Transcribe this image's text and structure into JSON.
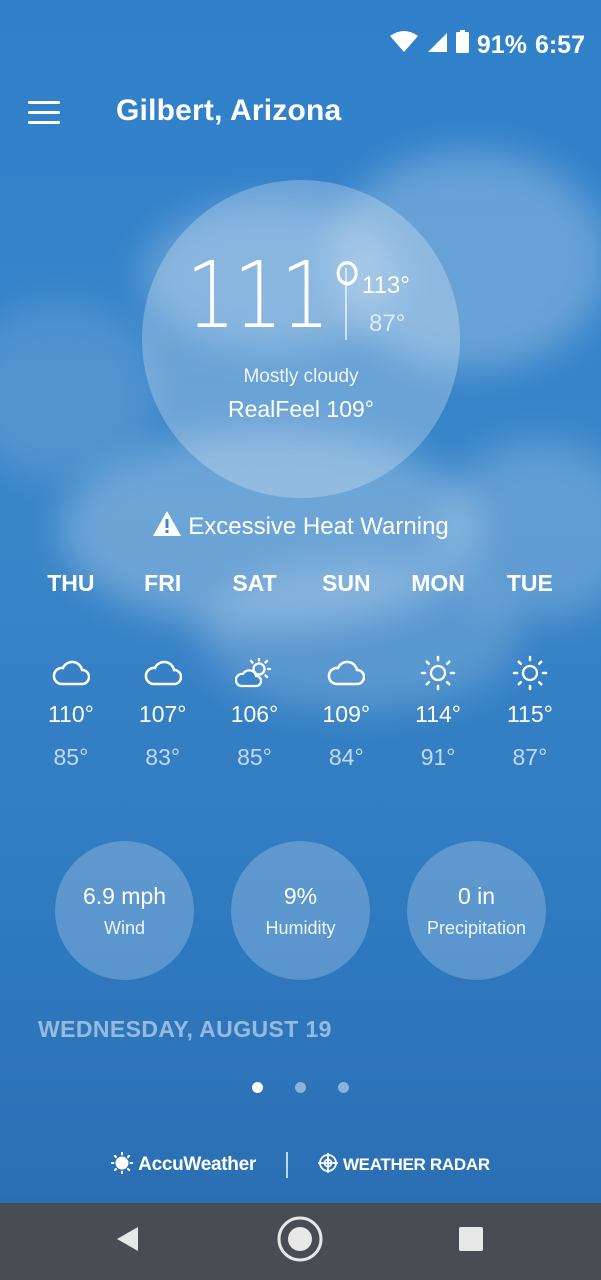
{
  "status_bar": {
    "battery": "91%",
    "time": "6:57",
    "icons": [
      "wifi-icon",
      "signal-icon",
      "battery-icon"
    ]
  },
  "header": {
    "city": "Gilbert, Arizona",
    "menu_icon": "hamburger-menu-icon"
  },
  "current": {
    "temperature": "111°",
    "high": "113°",
    "low": "87°",
    "condition": "Mostly cloudy",
    "realfeel": "RealFeel 109°"
  },
  "alert": {
    "text": "Excessive Heat Warning",
    "icon": "warning-icon"
  },
  "forecast": [
    {
      "day": "THU",
      "icon": "cloud-icon",
      "high": "110°",
      "low": "85°"
    },
    {
      "day": "FRI",
      "icon": "cloud-icon",
      "high": "107°",
      "low": "83°"
    },
    {
      "day": "SAT",
      "icon": "partly-sunny-icon",
      "high": "106°",
      "low": "85°"
    },
    {
      "day": "SUN",
      "icon": "cloud-icon",
      "high": "109°",
      "low": "84°"
    },
    {
      "day": "MON",
      "icon": "sun-icon",
      "high": "114°",
      "low": "91°"
    },
    {
      "day": "TUE",
      "icon": "sun-icon",
      "high": "115°",
      "low": "87°"
    }
  ],
  "stats": [
    {
      "value": "6.9 mph",
      "label": "Wind"
    },
    {
      "value": "9%",
      "label": "Humidity"
    },
    {
      "value": "0 in",
      "label": "Precipitation"
    }
  ],
  "date_heading": "WEDNESDAY, AUGUST 19",
  "pagination": {
    "count": 3,
    "active": 1
  },
  "footer": {
    "accuweather": "AccuWeather",
    "radar": "WEATHER RADAR"
  },
  "colors": {
    "sky": "#2f7fca",
    "nav_bar": "#474d53",
    "text": "#ffffff"
  }
}
